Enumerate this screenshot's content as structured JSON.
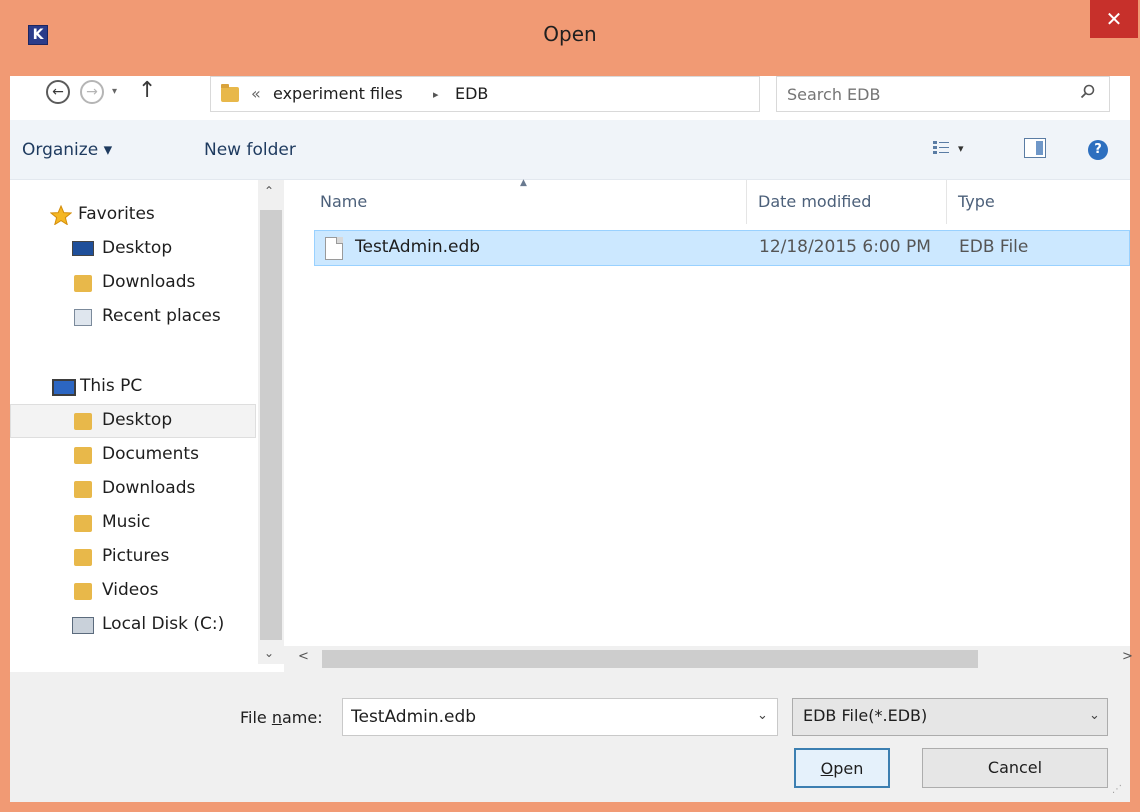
{
  "window": {
    "title": "Open",
    "app_icon_letter": "K",
    "close_glyph": "✕",
    "accent_color": "#f19a74",
    "close_color": "#c7302b"
  },
  "address": {
    "back_glyph": "←",
    "forward_glyph": "→",
    "recent_glyph": "▾",
    "up_glyph": "↑",
    "overflow": "«",
    "crumbs": [
      "experiment files",
      "EDB"
    ],
    "separator": "▸",
    "dropdown_glyph": "⌄",
    "refresh_glyph": "↻"
  },
  "search": {
    "placeholder": "Search EDB"
  },
  "toolbar": {
    "organize_label": "Organize ▾",
    "new_folder_label": "New folder",
    "view_dropdown_glyph": "▾",
    "help_glyph": "?"
  },
  "sidebar": {
    "favorites": {
      "label": "Favorites",
      "items": [
        {
          "label": "Desktop",
          "icon": "desktop-icon"
        },
        {
          "label": "Downloads",
          "icon": "downloads-icon"
        },
        {
          "label": "Recent places",
          "icon": "recent-places-icon"
        }
      ]
    },
    "this_pc": {
      "label": "This PC",
      "items": [
        {
          "label": "Desktop",
          "icon": "desktop-folder-icon",
          "selected": true
        },
        {
          "label": "Documents",
          "icon": "documents-icon"
        },
        {
          "label": "Downloads",
          "icon": "downloads-icon"
        },
        {
          "label": "Music",
          "icon": "music-icon"
        },
        {
          "label": "Pictures",
          "icon": "pictures-icon"
        },
        {
          "label": "Videos",
          "icon": "videos-icon"
        },
        {
          "label": "Local Disk (C:)",
          "icon": "local-disk-icon"
        }
      ]
    },
    "scroll_up_glyph": "⌃",
    "scroll_down_glyph": "⌄"
  },
  "file_list": {
    "columns": [
      "Name",
      "Date modified",
      "Type"
    ],
    "sort_glyph": "▲",
    "rows": [
      {
        "name": "TestAdmin.edb",
        "date_modified": "12/18/2015 6:00 PM",
        "type": "EDB File",
        "selected": true
      }
    ],
    "scroll_left_glyph": "<",
    "scroll_right_glyph": ">",
    "selection_color": "#cce8ff"
  },
  "bottom": {
    "file_name_label_prefix": "File ",
    "file_name_label_accel": "n",
    "file_name_label_suffix": "ame:",
    "file_name_value": "TestAdmin.edb",
    "combo_arrow": "⌄",
    "file_type_value": "EDB File(*.EDB)",
    "open_button_accel": "O",
    "open_button_rest": "pen",
    "cancel_button": "Cancel",
    "grip_glyph": "⋰"
  }
}
